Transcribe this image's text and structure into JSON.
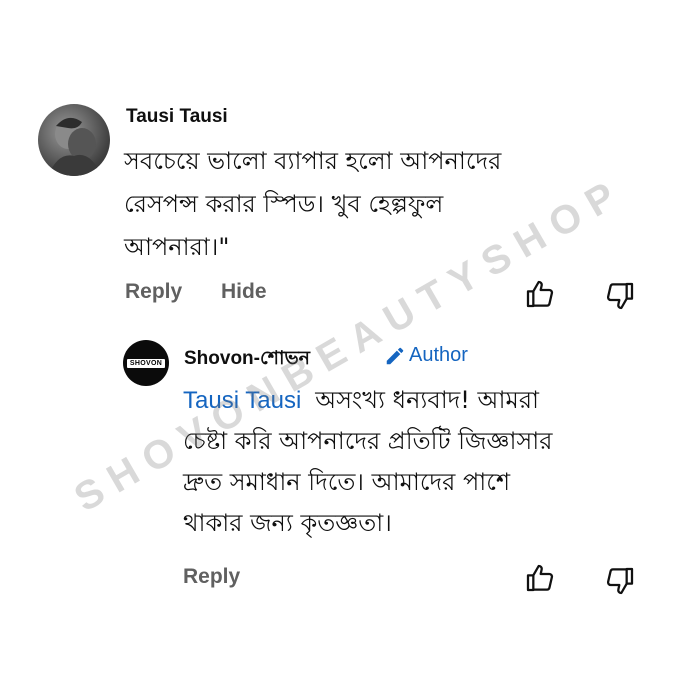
{
  "comment": {
    "author": "Tausi Tausi",
    "text_lines": [
      "সবচেয়ে ভালো ব্যাপার হলো আপনাদের",
      "রেসপন্স করার স্পিড। খুব হেল্পফুল",
      "আপনারা।\""
    ],
    "reply_label": "Reply",
    "hide_label": "Hide",
    "like_icon": "thumbs-up-icon",
    "dislike_icon": "thumbs-down-icon"
  },
  "reply": {
    "author": "Shovon-শোভন",
    "author_badge": "Author",
    "avatar_logo_text": "SHOVON",
    "mention": "Tausi Tausi",
    "text_lines": [
      "অসংখ্য ধন্যবাদ! আমরা",
      "চেষ্টা করি আপনাদের প্রতিটি জিজ্ঞাসার",
      "দ্রুত সমাধান দিতে। আমাদের পাশে",
      "থাকার জন্য কৃতজ্ঞতা।"
    ],
    "reply_label": "Reply",
    "like_icon": "thumbs-up-icon",
    "dislike_icon": "thumbs-down-icon"
  },
  "watermark": "SHOVONBEAUTYSHOP",
  "colors": {
    "text": "#0f0f0f",
    "secondary": "#606060",
    "accent_blue": "#1565c0",
    "watermark": "#787878"
  }
}
